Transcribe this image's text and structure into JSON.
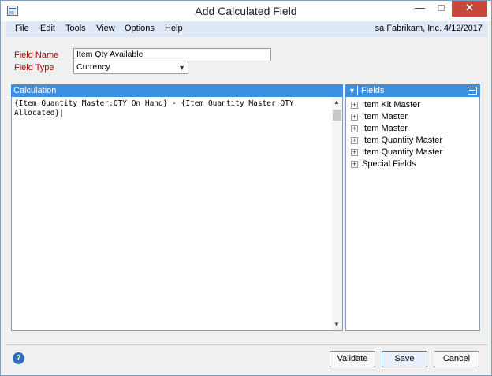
{
  "window": {
    "title": "Add Calculated Field",
    "controls": {
      "minimize": "—",
      "maximize": "□",
      "close": "✕"
    }
  },
  "menu": {
    "items": [
      "File",
      "Edit",
      "Tools",
      "View",
      "Options",
      "Help"
    ],
    "status": "sa  Fabrikam, Inc.  4/12/2017"
  },
  "form": {
    "field_name_label": "Field Name",
    "field_name_value": "Item Qty Available",
    "field_type_label": "Field Type",
    "field_type_value": "Currency"
  },
  "calculation": {
    "header": "Calculation",
    "text": "{Item Quantity Master:QTY On Hand} - {Item Quantity Master:QTY\nAllocated}|"
  },
  "fields_panel": {
    "header": "Fields",
    "items": [
      "Item Kit Master",
      "Item Master",
      "Item Master",
      "Item Quantity Master",
      "Item Quantity Master",
      "Special Fields"
    ]
  },
  "buttons": {
    "validate": "Validate",
    "save": "Save",
    "cancel": "Cancel",
    "help": "?"
  },
  "icons": {
    "app": "window-app-icon",
    "help": "help-icon",
    "expand": "plus-expand-icon"
  }
}
